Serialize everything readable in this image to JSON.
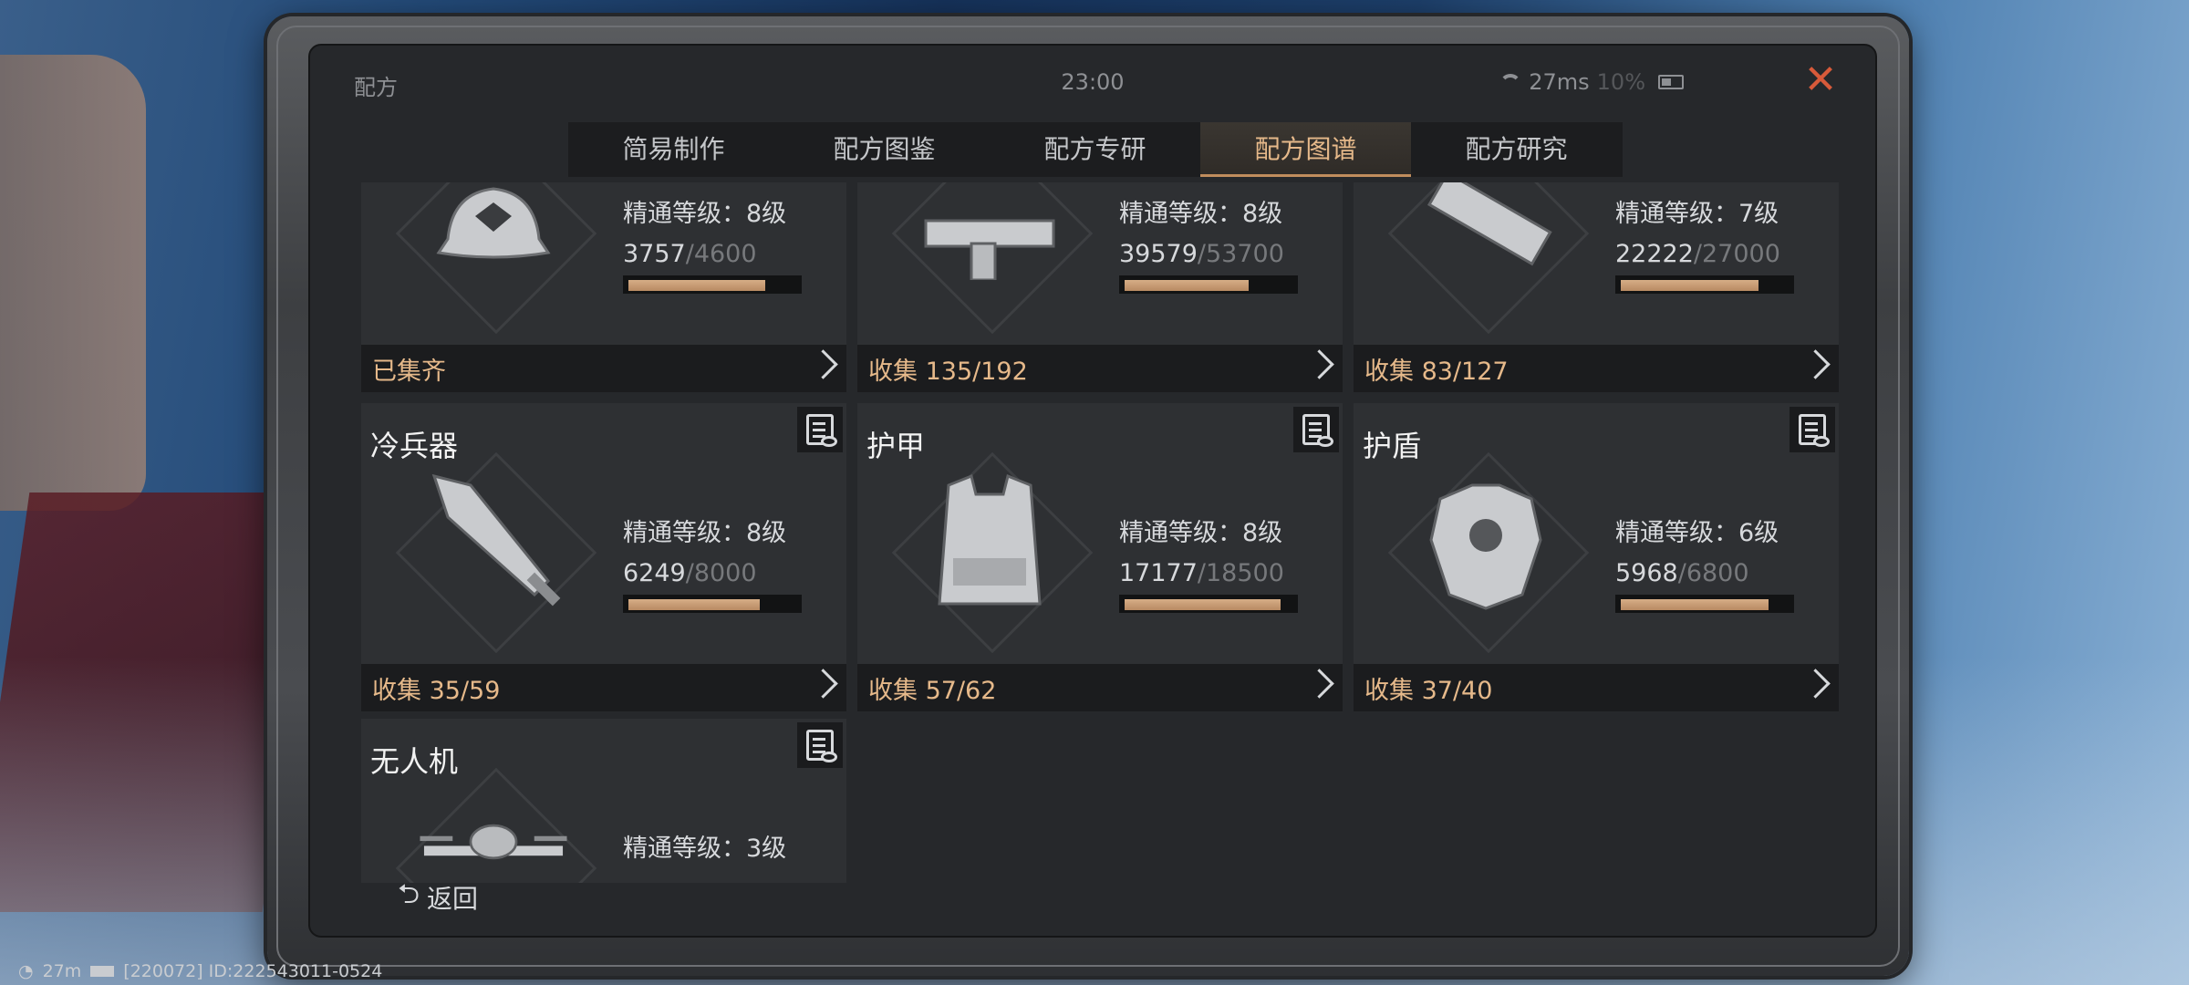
{
  "window": {
    "title": "配方",
    "clock": "23:00",
    "ping": "27ms",
    "battery_text": "10%",
    "close_icon": "close-icon"
  },
  "tabs": [
    {
      "label": "简易制作",
      "active": false
    },
    {
      "label": "配方图鉴",
      "active": false
    },
    {
      "label": "配方专研",
      "active": false
    },
    {
      "label": "配方图谱",
      "active": true
    },
    {
      "label": "配方研究",
      "active": false
    }
  ],
  "cards": [
    {
      "name": "",
      "level": "精通等级：8级",
      "cur": "3757",
      "max": "/4600",
      "progress": 0.817,
      "collect": "已集齐",
      "icon": "cap-icon"
    },
    {
      "name": "",
      "level": "精通等级：8级",
      "cur": "39579",
      "max": "/53700",
      "progress": 0.737,
      "collect": "收集 135/192",
      "icon": "smg-icon"
    },
    {
      "name": "",
      "level": "精通等级：7级",
      "cur": "22222",
      "max": "/27000",
      "progress": 0.823,
      "collect": "收集 83/127",
      "icon": "launcher-icon"
    },
    {
      "name": "冷兵器",
      "level": "精通等级：8级",
      "cur": "6249",
      "max": "/8000",
      "progress": 0.781,
      "collect": "收集 35/59",
      "icon": "blade-icon"
    },
    {
      "name": "护甲",
      "level": "精通等级：8级",
      "cur": "17177",
      "max": "/18500",
      "progress": 0.928,
      "collect": "收集 57/62",
      "icon": "vest-icon"
    },
    {
      "name": "护盾",
      "level": "精通等级：6级",
      "cur": "5968",
      "max": "/6800",
      "progress": 0.878,
      "collect": "收集 37/40",
      "icon": "shield-armor-icon"
    },
    {
      "name": "无人机",
      "level": "精通等级：3级",
      "cur": "",
      "max": "",
      "progress": null,
      "collect": "",
      "icon": "drone-icon"
    }
  ],
  "back_label": "返回",
  "footer": {
    "ping": "27m",
    "id_text": "[220072] ID:222543011-0524"
  },
  "colors": {
    "accent": "#e6b98a",
    "bar": "#c89a70",
    "close": "#d85a3a"
  }
}
